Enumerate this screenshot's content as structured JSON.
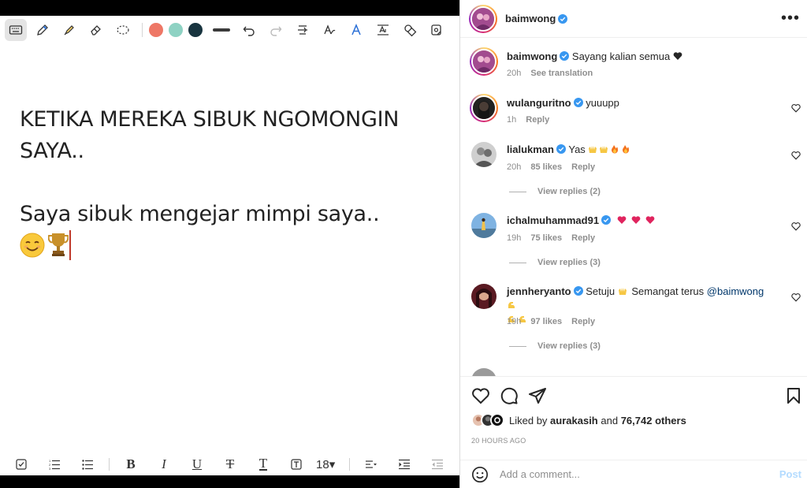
{
  "note": {
    "line1": "KETIKA MEREKA SIBUK NGOMONGIN",
    "line2": "SAYA..",
    "line3": "Saya sibuk mengejar mimpi saya..",
    "font_size": "18",
    "pen_colors": [
      "#ee7766",
      "#8ed2c3",
      "#18343f"
    ]
  },
  "post": {
    "author": "baimwong",
    "caption": {
      "username": "baimwong",
      "text": "Sayang kalian semua",
      "time": "20h",
      "see_translation": "See translation"
    },
    "comments": [
      {
        "username": "wulanguritno",
        "text": "yuuupp",
        "time": "1h",
        "likes": "",
        "reply": "Reply",
        "view_replies": ""
      },
      {
        "username": "lialukman",
        "text": "Yas",
        "time": "20h",
        "likes": "85 likes",
        "reply": "Reply",
        "view_replies": "View replies (2)"
      },
      {
        "username": "ichalmuhammad91",
        "text": "",
        "time": "19h",
        "likes": "75 likes",
        "reply": "Reply",
        "view_replies": "View replies (3)"
      },
      {
        "username": "jennheryanto",
        "text": "Setuju",
        "text2": "Semangat terus",
        "mention": "@baimwong",
        "time": "19h",
        "likes": "97 likes",
        "reply": "Reply",
        "view_replies": "View replies (3)"
      }
    ],
    "liked_by_prefix": "Liked by",
    "liked_by_user": "aurakasih",
    "liked_by_and": "and",
    "liked_by_others": "76,742 others",
    "posted_ago": "20 HOURS AGO",
    "comment_placeholder": "Add a comment...",
    "post_label": "Post"
  },
  "icons": {
    "verified_color": "#3897f0",
    "heart_red": "#e0245e"
  }
}
